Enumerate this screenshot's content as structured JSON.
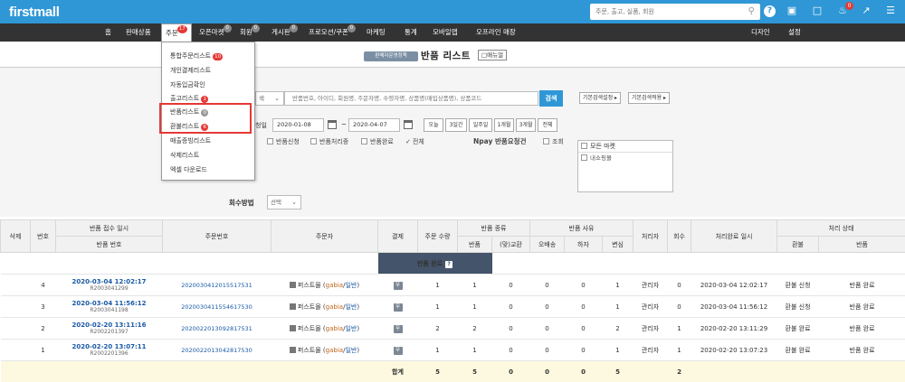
{
  "app": {
    "logo": "firstmall"
  },
  "top": {
    "search_placeholder": "주문, 출고, 실품, 회원",
    "help_label": "?",
    "notif_count": "0"
  },
  "nav": {
    "items": [
      "홈",
      "판매상품",
      "주문",
      "오픈마켓",
      "회원",
      "게시판",
      "프로모션/쿠폰",
      "마케팅",
      "통계",
      "모바일앱",
      "오프라인 매장"
    ],
    "order_badge": "17",
    "badge_openmarket": "0",
    "badge_member": "0",
    "badge_board": "0",
    "badge_promo": "0",
    "right": [
      "디자인",
      "설정"
    ]
  },
  "dropdown": {
    "items": [
      "통합주문리스트",
      "개인결제리스트",
      "자동입금확인",
      "출고리스트",
      "반품리스트",
      "환불리스트",
      "매출증빙리스트",
      "삭제리스트",
      "엑셀 다운로드"
    ],
    "badge_integrated": "10",
    "badge_shipping": "1",
    "badge_return": "0",
    "badge_refund": "6"
  },
  "header": {
    "badge": "판매자운영정책",
    "title": "반품 리스트",
    "manual": "매뉴얼"
  },
  "filters": {
    "search_type_suffix": "색",
    "keyword_placeholder": "반품번호, 아이디, 회원명, 주문자명, 수령자명, 상품명(매입상품명), 상품코드",
    "search_button": "검색",
    "default_setting": "기본검색설정 ▸",
    "default_apply": "기본검색적용 ▸",
    "date_label_suffix": "청일",
    "date_from": "2020-01-08",
    "date_sep": "~",
    "date_to": "2020-04-07",
    "periods": [
      "오늘",
      "3일간",
      "일주일",
      "1개월",
      "3개월",
      "전체"
    ],
    "status_checks": [
      "반품신청",
      "반품처리중",
      "반품완료"
    ],
    "status_all": "전체",
    "npay_label": "Npay 반품요청건",
    "npay_check": "조회",
    "market_all": "모든 마켓",
    "market_item": "내쇼핑몰",
    "return_method_label": "회수방법",
    "return_method_value": "선택"
  },
  "table": {
    "headers": {
      "delete": "삭제",
      "no": "번호",
      "received": "반품 접수 일시",
      "return_no": "반품 번호",
      "order_no": "주문번호",
      "orderer": "주문자",
      "payment": "결제",
      "return_qty": "주문 수량",
      "return_kind": "반품 종류",
      "kind_return": "반품",
      "kind_exchange": "(맞)교환",
      "return_reason": "반품 사유",
      "reason_defect": "오배송",
      "reason_damage": "하자",
      "reason_change": "변심",
      "processor": "처리자",
      "count": "회수",
      "done_at": "처리완료 일시",
      "status": "처리 상태",
      "status_refund": "환불",
      "status_return": "반품"
    },
    "group_label": "반품 완료",
    "group_help": "?",
    "rows": [
      {
        "no": "4",
        "received": "2020-03-04 12:02:17",
        "return_no": "R2003041299",
        "order_no": "2020030412015517531",
        "orderer": "퍼스트몰",
        "gabia": "gabia",
        "slash": "/",
        "general": "일반",
        "paymark": "무",
        "qty": "1",
        "kind_return": "1",
        "kind_exchange": "0",
        "r1": "0",
        "r2": "0",
        "r3": "1",
        "processor": "관리자",
        "count": "0",
        "done_at": "2020-03-04 12:02:17",
        "refund": "환불 신청",
        "ret": "반품 완료"
      },
      {
        "no": "3",
        "received": "2020-03-04 11:56:12",
        "return_no": "R2003041198",
        "order_no": "2020030411554617530",
        "orderer": "퍼스트몰",
        "gabia": "gabia",
        "slash": "/",
        "general": "일반",
        "paymark": "무",
        "qty": "1",
        "kind_return": "1",
        "kind_exchange": "0",
        "r1": "0",
        "r2": "0",
        "r3": "1",
        "processor": "관리자",
        "count": "0",
        "done_at": "2020-03-04 11:56:12",
        "refund": "환불 신청",
        "ret": "반품 완료"
      },
      {
        "no": "2",
        "received": "2020-02-20 13:11:16",
        "return_no": "R2002201397",
        "order_no": "2020022013092817531",
        "orderer": "퍼스트몰",
        "gabia": "gabia",
        "slash": "/",
        "general": "일반",
        "paymark": "무",
        "qty": "2",
        "kind_return": "2",
        "kind_exchange": "0",
        "r1": "0",
        "r2": "0",
        "r3": "2",
        "processor": "관리자",
        "count": "1",
        "done_at": "2020-02-20 13:11:29",
        "refund": "환불 완료",
        "ret": "반품 완료"
      },
      {
        "no": "1",
        "received": "2020-02-20 13:07:11",
        "return_no": "R2002201396",
        "order_no": "2020022013042817530",
        "orderer": "퍼스트몰",
        "gabia": "gabia",
        "slash": "/",
        "general": "일반",
        "paymark": "무",
        "qty": "1",
        "kind_return": "1",
        "kind_exchange": "0",
        "r1": "0",
        "r2": "0",
        "r3": "1",
        "processor": "관리자",
        "count": "1",
        "done_at": "2020-02-20 13:07:23",
        "refund": "환불 완료",
        "ret": "반품 완료"
      }
    ],
    "total": {
      "label": "합계",
      "qty": "5",
      "kind_return": "5",
      "kind_exchange": "0",
      "r1": "0",
      "r2": "0",
      "r3": "5",
      "count": "2"
    }
  },
  "colors": {
    "topbar": "#2f97d6",
    "navbar": "#333333",
    "accent": "#2f97d6",
    "highlight": "#e53935",
    "group_bg": "#44546a"
  }
}
